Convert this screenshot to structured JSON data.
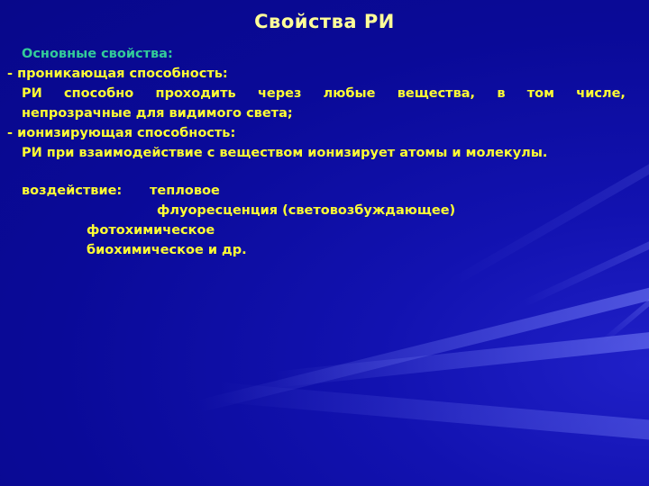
{
  "slide": {
    "title": "Свойства РИ",
    "colors": {
      "background": "#0a0a9a",
      "title": "#ffff99",
      "subtitle": "#33cc99",
      "text": "#ffff33"
    },
    "subtitle": "Основные свойства:",
    "lines": [
      "- проникающая способность:",
      "РИ способно проходить через любые вещества, в том числе,",
      "непрозрачные для видимого света;",
      "- ионизирующая способность:",
      "РИ при взаимодействие с веществом ионизирует атомы и молекулы."
    ],
    "justified_words": [
      "РИ",
      "способно",
      "проходить",
      "через",
      "любые",
      "вещества,",
      "в",
      "том",
      "числе,"
    ],
    "effects": {
      "label": "воздействие:",
      "items": [
        "тепловое",
        "флуоресценция (световозбуждающее)",
        "фотохимическое",
        "биохимическое и др."
      ]
    }
  }
}
